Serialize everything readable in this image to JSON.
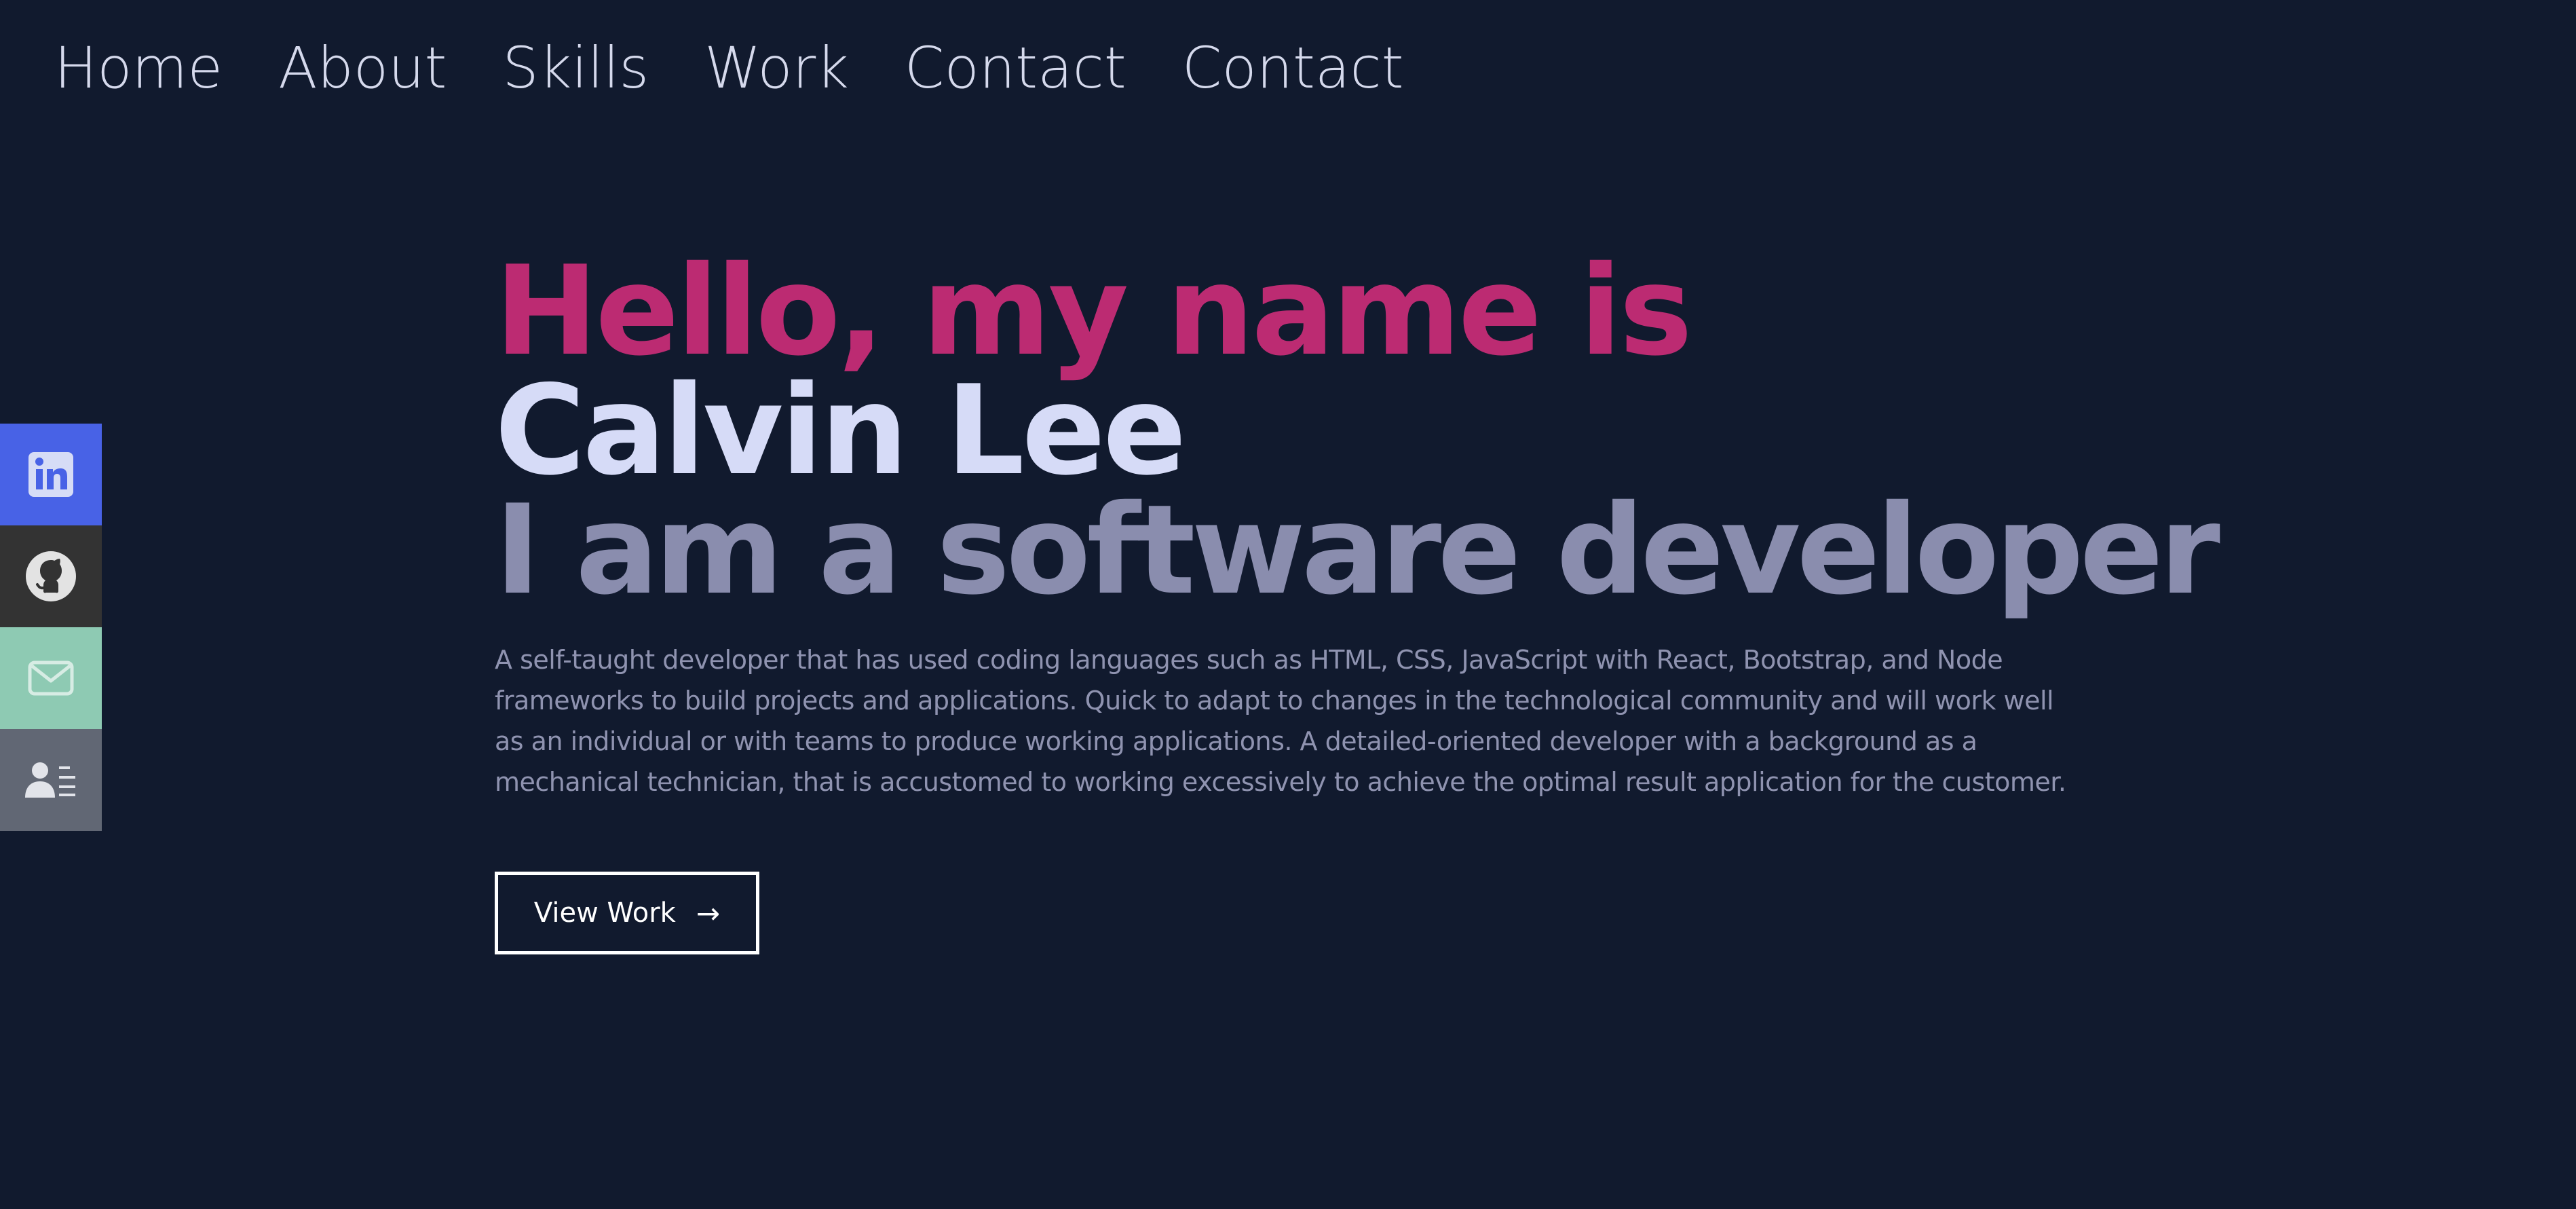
{
  "nav": {
    "items": [
      {
        "label": "Home"
      },
      {
        "label": "About"
      },
      {
        "label": "Skills"
      },
      {
        "label": "Work"
      },
      {
        "label": "Contact"
      },
      {
        "label": "Contact"
      }
    ]
  },
  "social": {
    "items": [
      {
        "icon": "linkedin-icon",
        "color": "#4862e6"
      },
      {
        "icon": "github-icon",
        "color": "#333333"
      },
      {
        "icon": "mail-icon",
        "color": "#8ecab3"
      },
      {
        "icon": "contact-card-icon",
        "color": "#616774"
      }
    ]
  },
  "hero": {
    "greeting": "Hello, my name is",
    "name": "Calvin Lee",
    "role": "I am a software developer",
    "description": "A self-taught developer that has used coding languages such as HTML, CSS, JavaScript with React, Bootstrap, and Node frameworks to build projects and applications. Quick to adapt to changes in the technological community and will work well as an individual or with teams to produce working applications. A detailed-oriented developer with a background as a mechanical technician, that is accustomed to working excessively to achieve the optimal result application for the customer.",
    "button_label": "View Work",
    "button_arrow": "→"
  },
  "colors": {
    "background": "#111a2e",
    "accent": "#bc2b72",
    "name": "#d6dbf7",
    "role": "#8a8dae",
    "description": "#8f93b0",
    "nav_text": "#d5d9ec"
  }
}
